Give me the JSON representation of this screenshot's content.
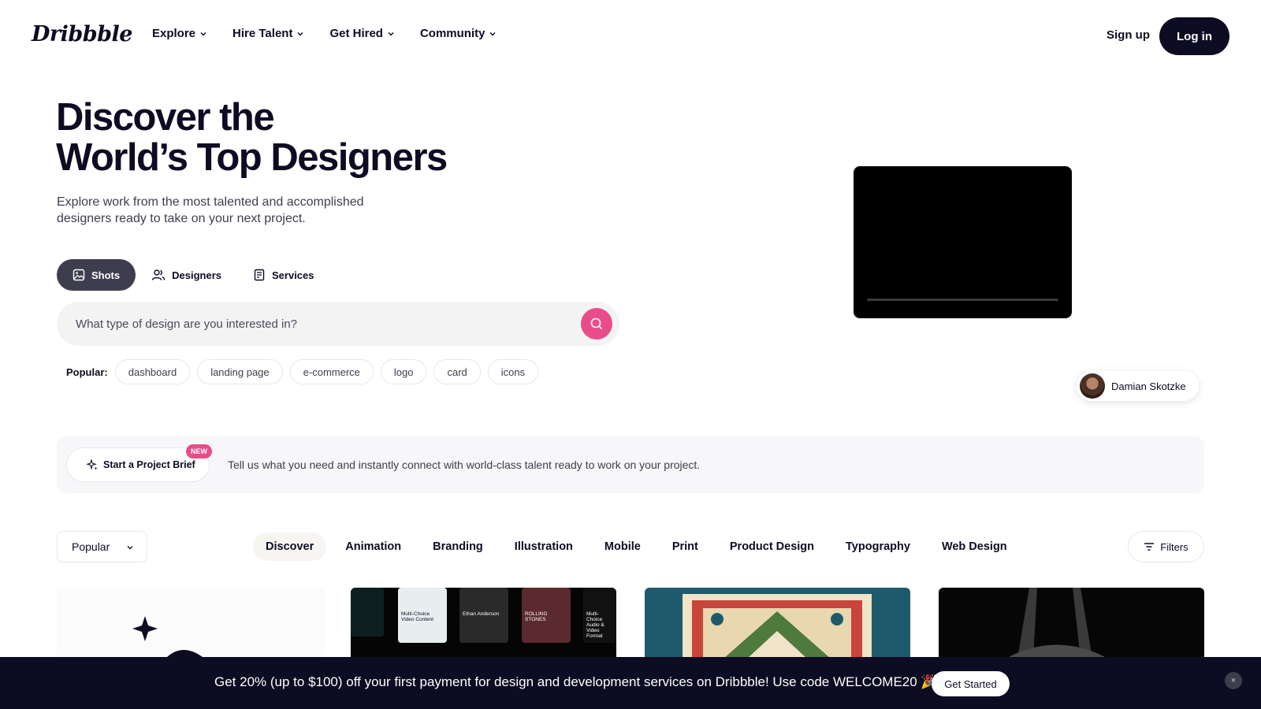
{
  "header": {
    "logo": "Dribbble",
    "nav": [
      {
        "label": "Explore"
      },
      {
        "label": "Hire Talent"
      },
      {
        "label": "Get Hired"
      },
      {
        "label": "Community"
      }
    ],
    "signup": "Sign up",
    "login": "Log in"
  },
  "hero": {
    "title_line1": "Discover the",
    "title_line2": "World’s Top Designers",
    "subtitle": "Explore work from the most talented and accomplished designers ready to take on your next project.",
    "tabs": [
      {
        "label": "Shots",
        "icon": "image-icon"
      },
      {
        "label": "Designers",
        "icon": "users-icon"
      },
      {
        "label": "Services",
        "icon": "document-icon"
      }
    ],
    "search_placeholder": "What type of design are you interested in?",
    "popular_label": "Popular:",
    "popular_tags": [
      "dashboard",
      "landing page",
      "e-commerce",
      "logo",
      "card",
      "icons"
    ],
    "designer_name": "Damian Skotzke"
  },
  "brief": {
    "button": "Start a Project Brief",
    "badge": "NEW",
    "text": "Tell us what you need and instantly connect with world-class talent ready to work on your project."
  },
  "filter_bar": {
    "sort": "Popular",
    "categories": [
      "Discover",
      "Animation",
      "Branding",
      "Illustration",
      "Mobile",
      "Print",
      "Product Design",
      "Typography",
      "Web Design"
    ],
    "filters": "Filters"
  },
  "shots": {
    "shot1_texts": [
      "Multi-Choice Video Content",
      "Ethan Anderson",
      "ROLLING STONES",
      "Multi-Choice Audio & Video Format"
    ]
  },
  "promo": {
    "text": "Get 20% (up to $100) off your first payment for design and development services on Dribbble! Use code WELCOME20 🎉",
    "button": "Get Started",
    "close": "×"
  },
  "colors": {
    "brand_dark": "#0d0c22",
    "accent_pink": "#ea4c89"
  }
}
